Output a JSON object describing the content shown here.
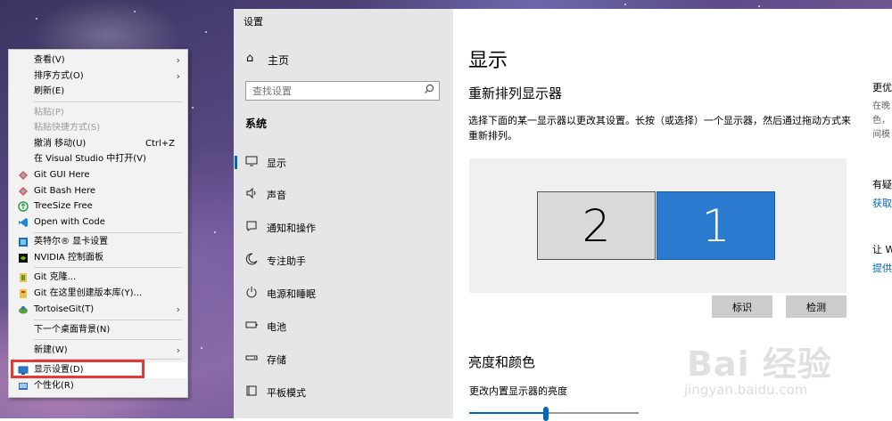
{
  "context_menu": {
    "items": [
      {
        "label": "查看(V)",
        "arrow": "›"
      },
      {
        "label": "排序方式(O)",
        "arrow": "›"
      },
      {
        "label": "刷新(E)"
      },
      {
        "label": "粘贴(P)"
      },
      {
        "label": "粘贴快捷方式(S)"
      },
      {
        "label": "撤消 移动(U)",
        "shortcut": "Ctrl+Z"
      },
      {
        "label": "在 Visual Studio 中打开(V)"
      },
      {
        "label": "Git GUI Here"
      },
      {
        "label": "Git Bash Here"
      },
      {
        "label": "TreeSize Free"
      },
      {
        "label": "Open with Code"
      },
      {
        "label": "英特尔® 显卡设置"
      },
      {
        "label": "NVIDIA 控制面板"
      },
      {
        "label": "Git 克隆..."
      },
      {
        "label": "Git 在这里创建版本库(Y)..."
      },
      {
        "label": "TortoiseGit(T)",
        "arrow": "›"
      },
      {
        "label": "下一个桌面背景(N)"
      },
      {
        "label": "新建(W)",
        "arrow": "›"
      },
      {
        "label": "显示设置(D)"
      },
      {
        "label": "个性化(R)"
      }
    ]
  },
  "settings": {
    "window_title": "设置",
    "home_label": "主页",
    "search_placeholder": "查找设置",
    "section_title": "系统",
    "nav": [
      {
        "label": "显示",
        "icon": "monitor-icon"
      },
      {
        "label": "声音",
        "icon": "speaker-icon"
      },
      {
        "label": "通知和操作",
        "icon": "notification-icon"
      },
      {
        "label": "专注助手",
        "icon": "moon-icon"
      },
      {
        "label": "电源和睡眠",
        "icon": "power-icon"
      },
      {
        "label": "电池",
        "icon": "battery-icon"
      },
      {
        "label": "存储",
        "icon": "storage-icon"
      },
      {
        "label": "平板模式",
        "icon": "tablet-icon"
      }
    ],
    "main": {
      "title": "显示",
      "rearrange_heading": "重新排列显示器",
      "rearrange_desc": "选择下面的某一显示器以更改其设置。长按（或选择）一个显示器，然后通过拖动方式来重新排列。",
      "monitor_2": "2",
      "monitor_1": "1",
      "identify_button": "标识",
      "detect_button": "检测",
      "brightness_heading": "亮度和颜色",
      "brightness_label": "更改内置显示器的亮度",
      "brightness_value": 0.45
    },
    "right_panel": {
      "heading": "更优",
      "text_line1": "在晚",
      "text_line2": "色，",
      "text_line3": "间模",
      "question": "有疑",
      "get_help": "获取",
      "feedback_heading": "让 W",
      "feedback_link": "提供"
    }
  },
  "watermark": {
    "main": "Bai 经验",
    "url": "jingyan.baidu.com"
  },
  "colors": {
    "accent": "#0067c0",
    "selected_monitor": "#2a7bd0",
    "highlight_border": "#e53935"
  }
}
